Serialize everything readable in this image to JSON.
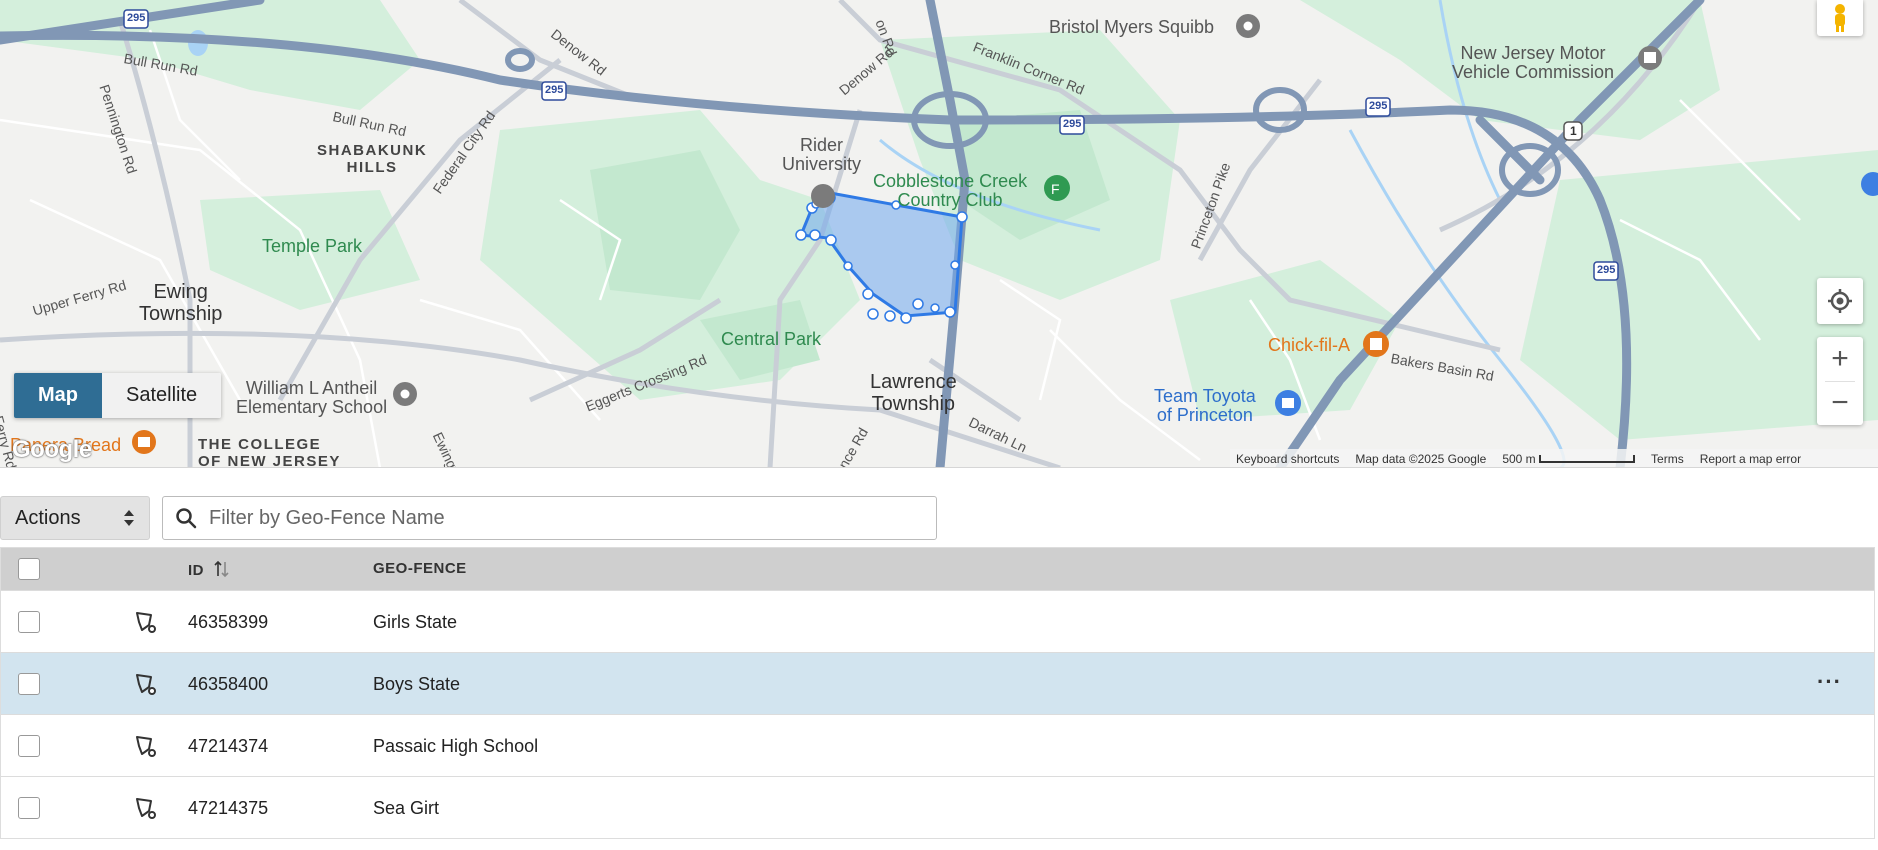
{
  "map": {
    "labels": {
      "bristol": "Bristol Myers Squibb",
      "njmvc": "New Jersey Motor\nVehicle Commission",
      "rider": "Rider\nUniversity",
      "cobblestone": "Cobblestone Creek\nCountry Club",
      "shabakunk": "SHABAKUNK\nHILLS",
      "temple_park": "Temple Park",
      "ewing": "Ewing\nTownship",
      "central_park": "Central Park",
      "lawrence": "Lawrence\nTownship",
      "chick": "Chick-fil-A",
      "toyota": "Team Toyota\nof Princeton",
      "anthe": "William L Antheil\nElementary School",
      "college": "THE COLLEGE\nOF NEW JERSEY",
      "panera": "Panera Bread",
      "bull_run_1": "Bull Run Rd",
      "bull_run_2": "Bull Run Rd",
      "pennington": "Pennington Rd",
      "federal_city": "Federal City Rd",
      "denow_1": "Denow Rd",
      "denow_2": "Denow Rd",
      "franklin": "Franklin Corner Rd",
      "princeton_pike": "Princeton Pike",
      "upper_ferry": "Upper Ferry Rd",
      "eggerts": "Eggerts Crossing Rd",
      "bakers": "Bakers Basin Rd",
      "darrah": "Darrah Ln",
      "ewingville": "Ewingville",
      "ence_rd": "ence Rd",
      "ferry": "Ferry Rd",
      "on_rd": "on Rd",
      "hwy_295": "295",
      "hwy_1": "1"
    },
    "map_type": {
      "map": "Map",
      "satellite": "Satellite",
      "selected": "Map"
    },
    "zoom_in": "+",
    "zoom_out": "−",
    "attribution": {
      "keyboard": "Keyboard shortcuts",
      "data": "Map data ©2025 Google",
      "scale": "500 m",
      "terms": "Terms",
      "report": "Report a map error"
    },
    "logo": "Google",
    "colors": {
      "fence_fill": "#6fa8ef",
      "fence_stroke": "#2f7ae5",
      "highway": "#8197b5",
      "park": "#cdecd7",
      "water": "#a9d3f5"
    }
  },
  "controls": {
    "actions_label": "Actions",
    "filter_placeholder": "Filter by Geo-Fence Name",
    "filter_value": ""
  },
  "table": {
    "headers": {
      "id": "ID",
      "geofence": "GEO-FENCE"
    },
    "rows": [
      {
        "id": "46358399",
        "name": "Girls State",
        "selected": false
      },
      {
        "id": "46358400",
        "name": "Boys State",
        "selected": true
      },
      {
        "id": "47214374",
        "name": "Passaic High School",
        "selected": false
      },
      {
        "id": "47214375",
        "name": "Sea Girt",
        "selected": false
      }
    ],
    "row_menu": "···"
  }
}
